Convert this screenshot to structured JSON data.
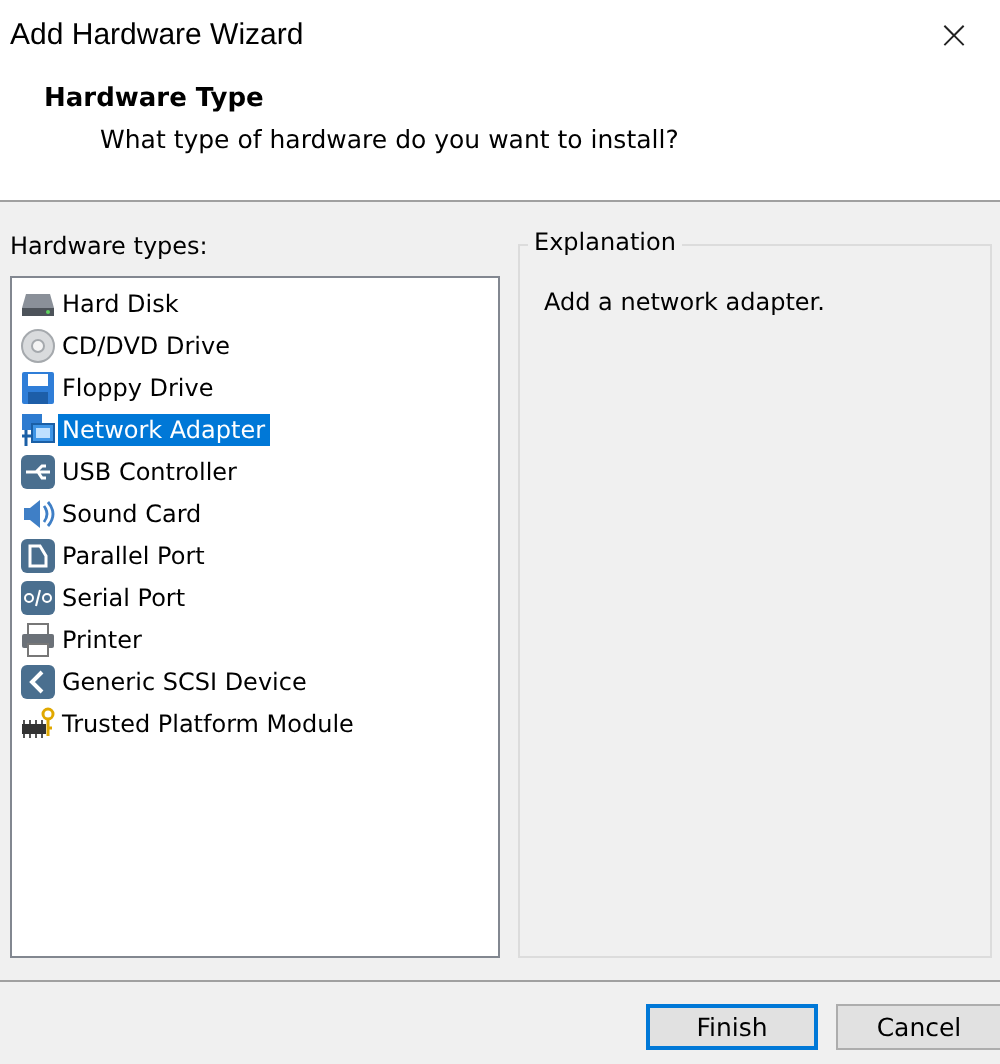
{
  "window": {
    "title": "Add Hardware Wizard",
    "close": "×"
  },
  "header": {
    "title": "Hardware Type",
    "subtitle": "What type of hardware do you want to install?"
  },
  "hardware_types": {
    "label": "Hardware types:",
    "items": [
      {
        "label": "Hard Disk",
        "kind": "disk",
        "selected": false
      },
      {
        "label": "CD/DVD Drive",
        "kind": "cd",
        "selected": false
      },
      {
        "label": "Floppy Drive",
        "kind": "floppy",
        "selected": false
      },
      {
        "label": "Network Adapter",
        "kind": "network",
        "selected": true
      },
      {
        "label": "USB Controller",
        "kind": "usb",
        "selected": false
      },
      {
        "label": "Sound Card",
        "kind": "sound",
        "selected": false
      },
      {
        "label": "Parallel Port",
        "kind": "parallel",
        "selected": false
      },
      {
        "label": "Serial Port",
        "kind": "serial",
        "selected": false
      },
      {
        "label": "Printer",
        "kind": "printer",
        "selected": false
      },
      {
        "label": "Generic SCSI Device",
        "kind": "scsi",
        "selected": false
      },
      {
        "label": "Trusted Platform Module",
        "kind": "tpm",
        "selected": false
      }
    ]
  },
  "explanation": {
    "title": "Explanation",
    "text": "Add a network adapter."
  },
  "buttons": [
    {
      "label": "Finish",
      "default": true
    },
    {
      "label": "Cancel",
      "default": false
    }
  ]
}
